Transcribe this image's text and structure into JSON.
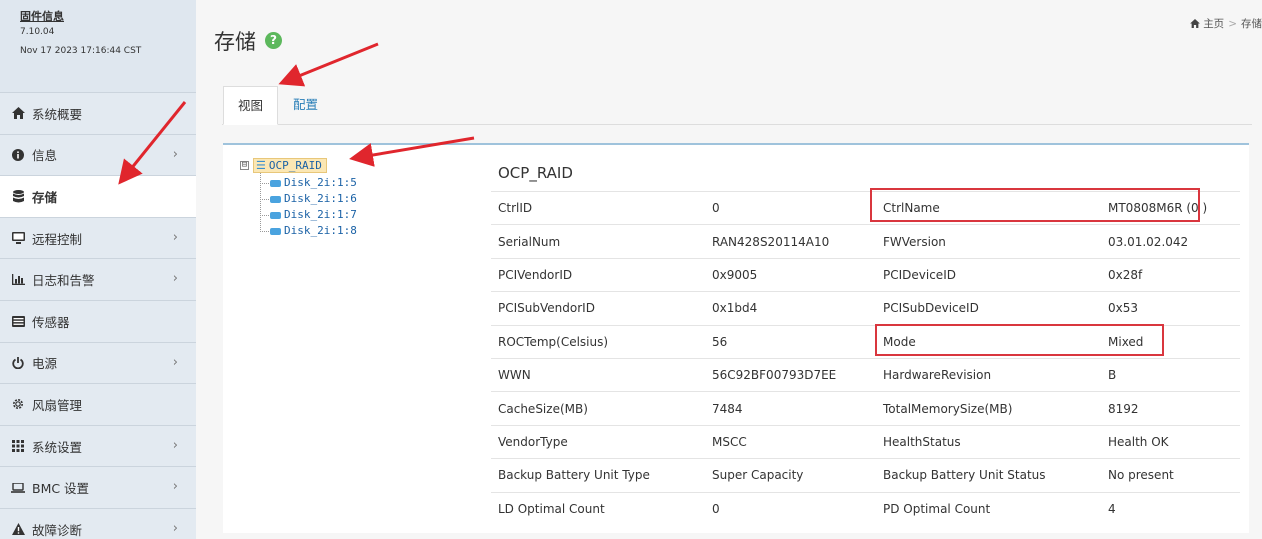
{
  "firmware": {
    "title": "固件信息",
    "version": "7.10.04",
    "build_date": "Nov 17 2023 17:16:44 CST"
  },
  "sidebar": {
    "items": [
      {
        "label": "系统概要",
        "icon": "home-icon",
        "has_submenu": false,
        "active": false
      },
      {
        "label": "信息",
        "icon": "info-circle-icon",
        "has_submenu": true,
        "active": false
      },
      {
        "label": "存储",
        "icon": "database-icon",
        "has_submenu": false,
        "active": true
      },
      {
        "label": "远程控制",
        "icon": "desktop-icon",
        "has_submenu": true,
        "active": false
      },
      {
        "label": "日志和告警",
        "icon": "bar-chart-icon",
        "has_submenu": true,
        "active": false
      },
      {
        "label": "传感器",
        "icon": "sensor-list-icon",
        "has_submenu": false,
        "active": false
      },
      {
        "label": "电源",
        "icon": "power-icon",
        "has_submenu": true,
        "active": false
      },
      {
        "label": "风扇管理",
        "icon": "gear-icon",
        "has_submenu": false,
        "active": false
      },
      {
        "label": "系统设置",
        "icon": "grid-icon",
        "has_submenu": true,
        "active": false
      },
      {
        "label": "BMC 设置",
        "icon": "laptop-icon",
        "has_submenu": true,
        "active": false
      },
      {
        "label": "故障诊断",
        "icon": "warning-icon",
        "has_submenu": true,
        "active": false
      }
    ]
  },
  "header": {
    "title": "存储",
    "help_icon": "question-circle-icon",
    "breadcrumb": {
      "home_icon": "home-icon",
      "home": "主页",
      "separator": ">",
      "current": "存储"
    }
  },
  "tabs": [
    {
      "label": "视图",
      "active": true
    },
    {
      "label": "配置",
      "active": false
    }
  ],
  "tree": {
    "root": {
      "label": "OCP_RAID",
      "icon": "raid-controller-icon",
      "expanded": true,
      "toggle": "⊟"
    },
    "children": [
      "Disk_2i:1:5",
      "Disk_2i:1:6",
      "Disk_2i:1:7",
      "Disk_2i:1:8"
    ]
  },
  "info": {
    "title": "OCP_RAID",
    "rows": [
      [
        "CtrlID",
        "0",
        "CtrlName",
        "MT0808M6R (0 )"
      ],
      [
        "SerialNum",
        "RAN428S20114A10",
        "FWVersion",
        "03.01.02.042"
      ],
      [
        "PCIVendorID",
        "0x9005",
        "PCIDeviceID",
        "0x28f"
      ],
      [
        "PCISubVendorID",
        "0x1bd4",
        "PCISubDeviceID",
        "0x53"
      ],
      [
        "ROCTemp(Celsius)",
        "56",
        "Mode",
        "Mixed"
      ],
      [
        "WWN",
        "56C92BF00793D7EE",
        "HardwareRevision",
        "B"
      ],
      [
        "CacheSize(MB)",
        "7484",
        "TotalMemorySize(MB)",
        "8192"
      ],
      [
        "VendorType",
        "MSCC",
        "HealthStatus",
        "Health OK"
      ],
      [
        "Backup Battery Unit Type",
        "Super Capacity",
        "Backup Battery Unit Status",
        "No present"
      ],
      [
        "LD Optimal Count",
        "0",
        "PD Optimal Count",
        "4"
      ]
    ]
  },
  "annotation_color": "#d9363e"
}
